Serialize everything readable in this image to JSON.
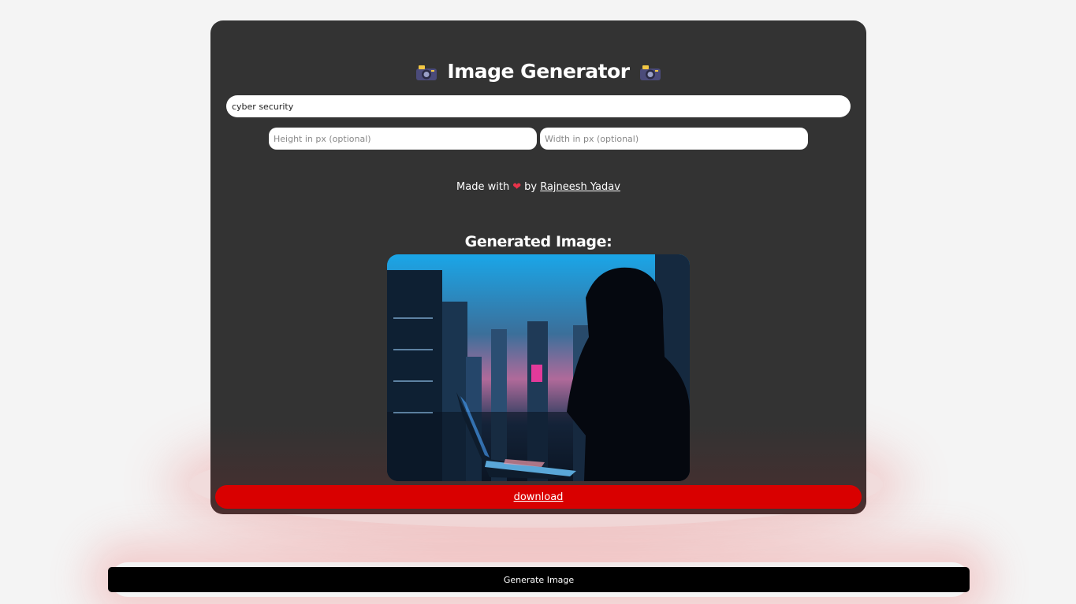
{
  "header": {
    "title": "Image Generator",
    "icon_left": "camera-icon",
    "icon_right": "camera-icon"
  },
  "form": {
    "prompt_value": "cyber security",
    "height_placeholder": "Height in px (optional)",
    "width_placeholder": "Width in px (optional)"
  },
  "credit": {
    "prefix": "Made with",
    "heart_icon": "heart-icon",
    "by": "by",
    "author": "Rajneesh Yadav"
  },
  "result": {
    "heading": "Generated Image:",
    "image_icon": "generated-image",
    "download_label": "download"
  },
  "actions": {
    "generate_label": "Generate Image"
  },
  "colors": {
    "card_bg": "#333333",
    "download_bg": "#d90000",
    "generate_bg": "#000000",
    "page_bg": "#f4f4f4"
  }
}
